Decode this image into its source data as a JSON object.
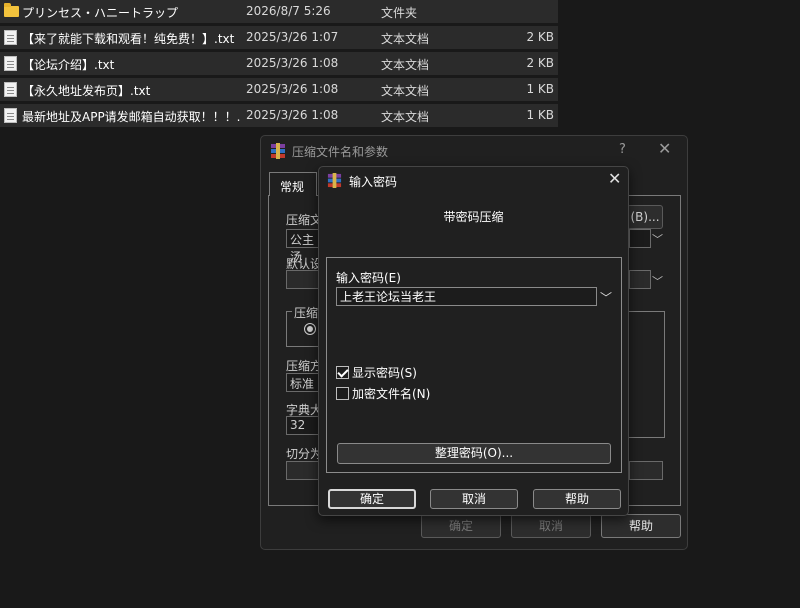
{
  "files": [
    {
      "name": "プリンセス・ハニートラップ",
      "date": "2026/8/7 5:26",
      "type": "文件夹",
      "size": "",
      "icon": "folder-icon"
    },
    {
      "name": "【来了就能下载和观看！纯免费！】.txt",
      "date": "2025/3/26 1:07",
      "type": "文本文档",
      "size": "2 KB",
      "icon": "text-file-icon"
    },
    {
      "name": "【论坛介绍】.txt",
      "date": "2025/3/26 1:08",
      "type": "文本文档",
      "size": "2 KB",
      "icon": "text-file-icon"
    },
    {
      "name": "【永久地址发布页】.txt",
      "date": "2025/3/26 1:08",
      "type": "文本文档",
      "size": "1 KB",
      "icon": "text-file-icon"
    },
    {
      "name": "最新地址及APP请发邮箱自动获取！！！....",
      "date": "2025/3/26 1:08",
      "type": "文本文档",
      "size": "1 KB",
      "icon": "text-file-icon"
    }
  ],
  "back_dialog": {
    "title": "压缩文件名和参数",
    "help": "?",
    "close": "✕",
    "tab": "常规",
    "archive_name_label": "压缩文",
    "archive_name_value": "公主汤",
    "browse_label": "(B)...",
    "profile_label": "默认设",
    "format_group_label": "压缩",
    "method_label": "压缩方",
    "method_value": "标准",
    "dict_label": "字典大",
    "dict_value": "32",
    "split_label": "切分为",
    "ok": "确定",
    "cancel": "取消",
    "help_btn": "帮助"
  },
  "dialog": {
    "title": "输入密码",
    "close": "✕",
    "subtitle": "带密码压缩",
    "password_label": "输入密码(E)",
    "password_value": "上老王论坛当老王",
    "show_password": "显示密码(S)",
    "show_password_checked": true,
    "encrypt_names": "加密文件名(N)",
    "encrypt_names_checked": false,
    "organize_button": "整理密码(O)...",
    "ok": "确定",
    "cancel": "取消",
    "help": "帮助"
  }
}
